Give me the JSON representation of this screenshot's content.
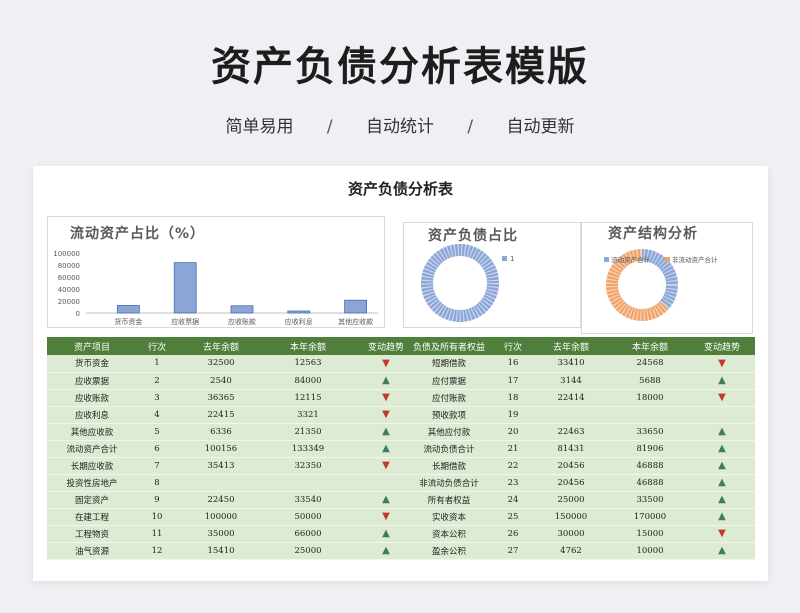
{
  "hero": {
    "title": "资产负债分析表模版",
    "tags": [
      "简单易用",
      "自动统计",
      "自动更新"
    ],
    "separator": "/"
  },
  "sheet": {
    "title": "资产负债分析表"
  },
  "charts": {
    "liquid": {
      "title": "流动资产占比（%）",
      "chart_data": {
        "type": "bar",
        "categories": [
          "货币资金",
          "应收票据",
          "应收账款",
          "应收利息",
          "其他应收款"
        ],
        "values": [
          12563,
          84000,
          12115,
          3321,
          21350
        ],
        "yticks": [
          "100000",
          "80000",
          "60000",
          "40000",
          "20000",
          "0"
        ],
        "ylim": [
          0,
          100000
        ]
      }
    },
    "liability": {
      "title": "资产负债占比",
      "legend": "1",
      "chart_data": {
        "type": "pie",
        "values": [
          1
        ],
        "labels": [
          "1"
        ]
      }
    },
    "structure": {
      "title": "资产结构分析",
      "legend": [
        "流动资产合计",
        "非流动资产合计"
      ],
      "chart_data": {
        "type": "pie",
        "labels": [
          "流动资产合计",
          "非流动资产合计"
        ],
        "values": [
          133349,
          230000
        ]
      }
    }
  },
  "colors": {
    "header_green": "#4f7f3a",
    "row_green": "#dcebd2",
    "bar_blue": "#6f8fc9",
    "donut_orange": "#f0a46c",
    "up": "#3f7d5a",
    "down": "#c0392b"
  },
  "left_table": {
    "headers": [
      "资产项目",
      "行次",
      "去年余额",
      "本年余额",
      "变动趋势"
    ],
    "rows": [
      {
        "name": "货币资金",
        "row": "1",
        "last": "32500",
        "this": "12563",
        "trend": "down"
      },
      {
        "name": "应收票据",
        "row": "2",
        "last": "2540",
        "this": "84000",
        "trend": "up"
      },
      {
        "name": "应收账款",
        "row": "3",
        "last": "36365",
        "this": "12115",
        "trend": "down"
      },
      {
        "name": "应收利息",
        "row": "4",
        "last": "22415",
        "this": "3321",
        "trend": "down"
      },
      {
        "name": "其他应收款",
        "row": "5",
        "last": "6336",
        "this": "21350",
        "trend": "up"
      },
      {
        "name": "流动资产合计",
        "row": "6",
        "last": "100156",
        "this": "133349",
        "trend": "up"
      },
      {
        "name": "长期应收款",
        "row": "7",
        "last": "35413",
        "this": "32350",
        "trend": "down"
      },
      {
        "name": "投资性房地产",
        "row": "8",
        "last": "",
        "this": "",
        "trend": ""
      },
      {
        "name": "固定资产",
        "row": "9",
        "last": "22450",
        "this": "33540",
        "trend": "up"
      },
      {
        "name": "在建工程",
        "row": "10",
        "last": "100000",
        "this": "50000",
        "trend": "down"
      },
      {
        "name": "工程物资",
        "row": "11",
        "last": "35000",
        "this": "66000",
        "trend": "up"
      },
      {
        "name": "油气资源",
        "row": "12",
        "last": "15410",
        "this": "25000",
        "trend": "up"
      }
    ]
  },
  "right_table": {
    "headers": [
      "负债及所有者权益",
      "行次",
      "去年余额",
      "本年余额",
      "变动趋势"
    ],
    "rows": [
      {
        "name": "短期借款",
        "row": "16",
        "last": "33410",
        "this": "24568",
        "trend": "down"
      },
      {
        "name": "应付票据",
        "row": "17",
        "last": "3144",
        "this": "5688",
        "trend": "up"
      },
      {
        "name": "应付账款",
        "row": "18",
        "last": "22414",
        "this": "18000",
        "trend": "down"
      },
      {
        "name": "预收款项",
        "row": "19",
        "last": "",
        "this": "",
        "trend": ""
      },
      {
        "name": "其他应付款",
        "row": "20",
        "last": "22463",
        "this": "33650",
        "trend": "up"
      },
      {
        "name": "流动负债合计",
        "row": "21",
        "last": "81431",
        "this": "81906",
        "trend": "up"
      },
      {
        "name": "长期借款",
        "row": "22",
        "last": "20456",
        "this": "46888",
        "trend": "up"
      },
      {
        "name": "非流动负债合计",
        "row": "23",
        "last": "20456",
        "this": "46888",
        "trend": "up"
      },
      {
        "name": "所有者权益",
        "row": "24",
        "last": "25000",
        "this": "33500",
        "trend": "up"
      },
      {
        "name": "实收资本",
        "row": "25",
        "last": "150000",
        "this": "170000",
        "trend": "up"
      },
      {
        "name": "资本公积",
        "row": "26",
        "last": "30000",
        "this": "15000",
        "trend": "down"
      },
      {
        "name": "盈余公积",
        "row": "27",
        "last": "4762",
        "this": "10000",
        "trend": "up"
      }
    ]
  }
}
